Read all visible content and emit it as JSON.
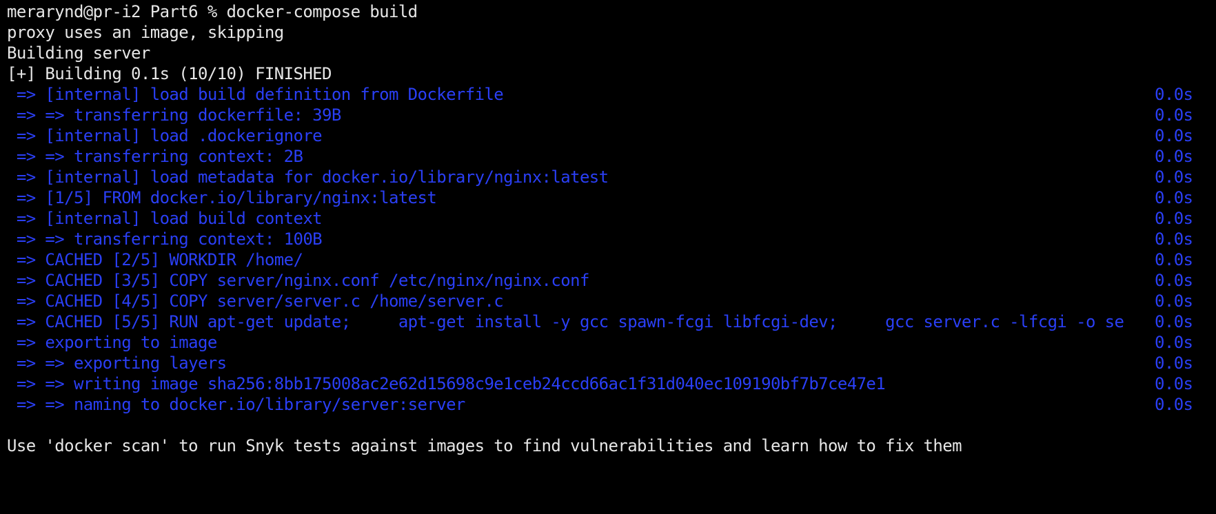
{
  "terminal": {
    "prompt_line": "merarynd@pr-i2 Part6 % docker-compose build",
    "header_lines": [
      "proxy uses an image, skipping",
      "Building server",
      "[+] Building 0.1s (10/10) FINISHED"
    ],
    "steps": [
      {
        "text": " => [internal] load build definition from Dockerfile",
        "time": "0.0s"
      },
      {
        "text": " => => transferring dockerfile: 39B",
        "time": "0.0s"
      },
      {
        "text": " => [internal] load .dockerignore",
        "time": "0.0s"
      },
      {
        "text": " => => transferring context: 2B",
        "time": "0.0s"
      },
      {
        "text": " => [internal] load metadata for docker.io/library/nginx:latest",
        "time": "0.0s"
      },
      {
        "text": " => [1/5] FROM docker.io/library/nginx:latest",
        "time": "0.0s"
      },
      {
        "text": " => [internal] load build context",
        "time": "0.0s"
      },
      {
        "text": " => => transferring context: 100B",
        "time": "0.0s"
      },
      {
        "text": " => CACHED [2/5] WORKDIR /home/",
        "time": "0.0s"
      },
      {
        "text": " => CACHED [3/5] COPY server/nginx.conf /etc/nginx/nginx.conf",
        "time": "0.0s"
      },
      {
        "text": " => CACHED [4/5] COPY server/server.c /home/server.c",
        "time": "0.0s"
      },
      {
        "text": " => CACHED [5/5] RUN apt-get update;     apt-get install -y gcc spawn-fcgi libfcgi-dev;     gcc server.c -lfcgi -o se",
        "time": "0.0s"
      },
      {
        "text": " => exporting to image",
        "time": "0.0s"
      },
      {
        "text": " => => exporting layers",
        "time": "0.0s"
      },
      {
        "text": " => => writing image sha256:8bb175008ac2e62d15698c9e1ceb24ccd66ac1f31d040ec109190bf7b7ce47e1",
        "time": "0.0s"
      },
      {
        "text": " => => naming to docker.io/library/server:server",
        "time": "0.0s"
      }
    ],
    "footer_line": "Use 'docker scan' to run Snyk tests against images to find vulnerabilities and learn how to fix them",
    "colors": {
      "background": "#000000",
      "text": "#e6e6e6",
      "build_step": "#2a3ff5"
    }
  }
}
